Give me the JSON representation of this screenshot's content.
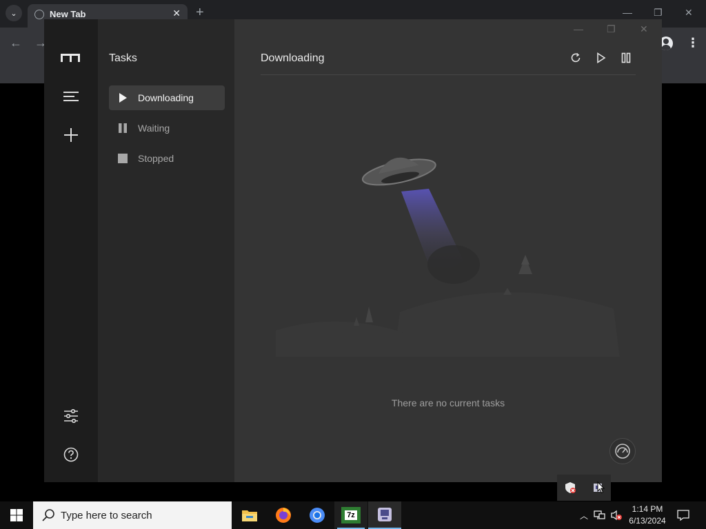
{
  "browser": {
    "tab_title": "New Tab",
    "new_tab_symbol": "+",
    "close_symbol": "✕"
  },
  "app": {
    "sidebar_title": "Tasks",
    "nav_items": [
      {
        "label": "Downloading",
        "icon": "play-icon",
        "active": true
      },
      {
        "label": "Waiting",
        "icon": "pause-icon",
        "active": false
      },
      {
        "label": "Stopped",
        "icon": "stop-icon",
        "active": false
      }
    ],
    "main_title": "Downloading",
    "empty_message": "There are no current tasks",
    "toolbar_icons": [
      "refresh-icon",
      "resume-all-icon",
      "pause-all-icon"
    ],
    "rail_icons": [
      "motrix-logo",
      "menu-icon",
      "add-task-icon",
      "preferences-icon",
      "help-icon"
    ]
  },
  "taskbar": {
    "search_placeholder": "Type here to search",
    "time": "1:14 PM",
    "date": "6/13/2024",
    "apps": [
      "file-explorer-icon",
      "firefox-icon",
      "chrome-icon",
      "7zip-icon",
      "motrix-icon"
    ],
    "sevenzip_label": "7z"
  },
  "colors": {
    "accent": "#76b9ed",
    "rail_bg": "#1d1d1d",
    "subnav_bg": "#282828",
    "main_bg": "#343434"
  }
}
